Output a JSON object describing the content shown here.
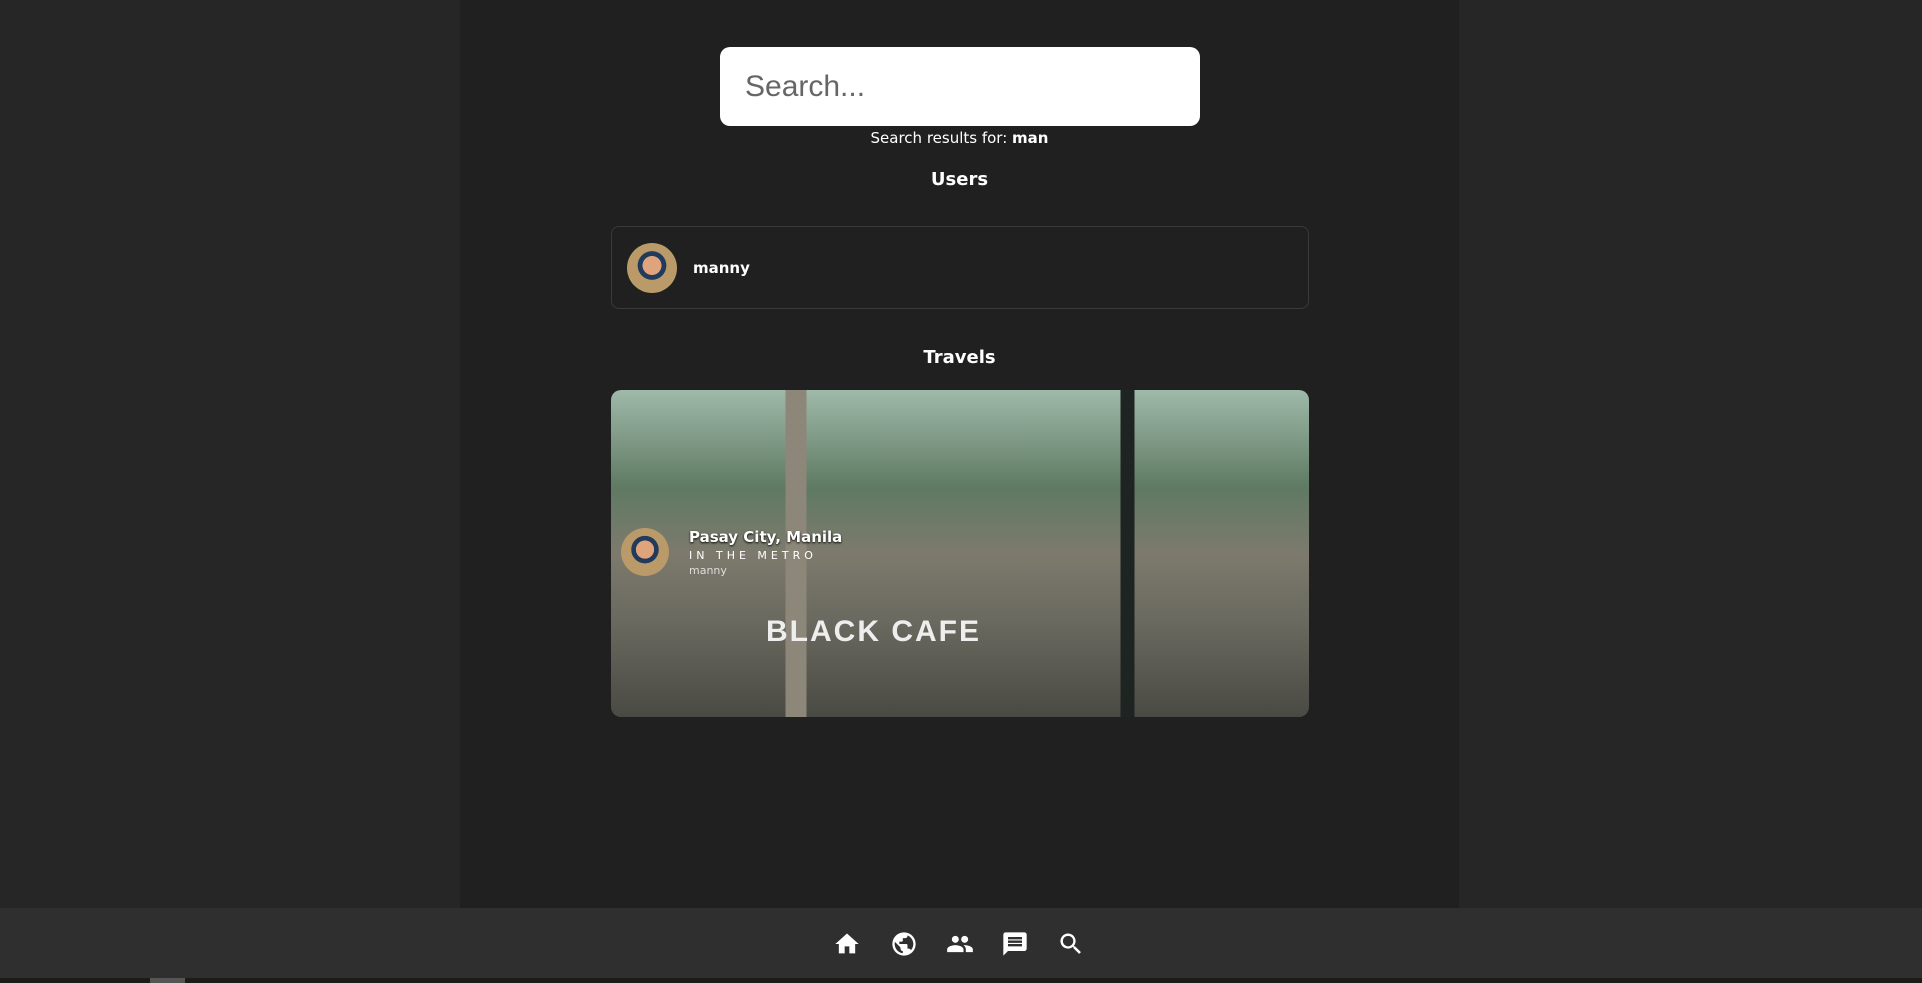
{
  "search": {
    "placeholder": "Search...",
    "results_prefix": "Search results for: ",
    "query": "man"
  },
  "users": {
    "heading": "Users",
    "items": [
      {
        "username": "manny"
      }
    ]
  },
  "travels": {
    "heading": "Travels",
    "items": [
      {
        "location": "Pasay City, Manila",
        "category": "IN THE METRO",
        "username": "manny",
        "image_sign": "BLACK CAFE"
      }
    ]
  },
  "nav": {
    "items": [
      "home-icon",
      "globe-icon",
      "people-icon",
      "chat-icon",
      "search-icon"
    ]
  }
}
